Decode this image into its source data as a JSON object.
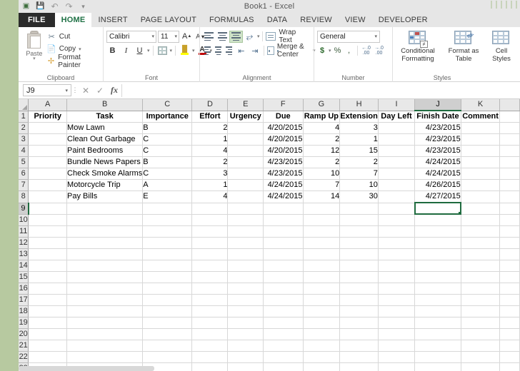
{
  "window": {
    "title": "Book1 - Excel",
    "quick_access": [
      "excel-logo",
      "save-icon",
      "undo-icon",
      "redo-icon",
      "customize-qat-icon"
    ]
  },
  "tabs": [
    {
      "label": "FILE",
      "state": "file"
    },
    {
      "label": "HOME",
      "state": "active"
    },
    {
      "label": "INSERT",
      "state": "normal"
    },
    {
      "label": "PAGE LAYOUT",
      "state": "normal"
    },
    {
      "label": "FORMULAS",
      "state": "normal"
    },
    {
      "label": "DATA",
      "state": "normal"
    },
    {
      "label": "REVIEW",
      "state": "normal"
    },
    {
      "label": "VIEW",
      "state": "normal"
    },
    {
      "label": "DEVELOPER",
      "state": "normal"
    }
  ],
  "ribbon": {
    "clipboard": {
      "group_label": "Clipboard",
      "paste_label": "Paste",
      "cut_label": "Cut",
      "copy_label": "Copy",
      "format_painter_label": "Format Painter"
    },
    "font": {
      "group_label": "Font",
      "font_name": "Calibri",
      "font_size": "11",
      "bold_label": "B",
      "italic_label": "I",
      "underline_label": "U",
      "grow_font_label": "A",
      "shrink_font_label": "A",
      "font_color_label": "A"
    },
    "alignment": {
      "group_label": "Alignment",
      "wrap_text_label": "Wrap Text",
      "merge_center_label": "Merge & Center"
    },
    "number": {
      "group_label": "Number",
      "format": "General",
      "currency_label": "$",
      "percent_label": "%",
      "comma_label": ","
    },
    "styles": {
      "group_label": "Styles",
      "conditional_formatting_label": "Conditional Formatting",
      "format_as_table_label": "Format as Table",
      "cell_styles_label": "Cell Styles"
    }
  },
  "formula_bar": {
    "name_box": "J9",
    "cancel_label": "✕",
    "enter_label": "✓",
    "function_label": "fx",
    "formula_value": ""
  },
  "sheet": {
    "columns": [
      "A",
      "B",
      "C",
      "D",
      "E",
      "F",
      "G",
      "H",
      "I",
      "J",
      "K"
    ],
    "selected_column": "J",
    "selected_row": 9,
    "selected_cell": "J9",
    "row_count": 23,
    "headers": [
      "Priority",
      "Task",
      "Importance",
      "Effort",
      "Urgency",
      "Due",
      "Ramp Up",
      "Extension",
      "Day Left",
      "Finish Date",
      "Comment"
    ],
    "rows": [
      {
        "priority": "",
        "task": "Mow Lawn",
        "importance": "B",
        "effort": "2",
        "urgency": "",
        "due": "4/20/2015",
        "ramp_up": "4",
        "extension": "3",
        "day_left": "",
        "finish_date": "4/23/2015",
        "comment": ""
      },
      {
        "priority": "",
        "task": "Clean Out Garbage",
        "importance": "C",
        "effort": "1",
        "urgency": "",
        "due": "4/20/2015",
        "ramp_up": "2",
        "extension": "1",
        "day_left": "",
        "finish_date": "4/23/2015",
        "comment": ""
      },
      {
        "priority": "",
        "task": "Paint Bedrooms",
        "importance": "C",
        "effort": "4",
        "urgency": "",
        "due": "4/20/2015",
        "ramp_up": "12",
        "extension": "15",
        "day_left": "",
        "finish_date": "4/23/2015",
        "comment": ""
      },
      {
        "priority": "",
        "task": "Bundle News Papers",
        "importance": "B",
        "effort": "2",
        "urgency": "",
        "due": "4/23/2015",
        "ramp_up": "2",
        "extension": "2",
        "day_left": "",
        "finish_date": "4/24/2015",
        "comment": ""
      },
      {
        "priority": "",
        "task": "Check Smoke Alarms",
        "importance": "C",
        "effort": "3",
        "urgency": "",
        "due": "4/23/2015",
        "ramp_up": "10",
        "extension": "7",
        "day_left": "",
        "finish_date": "4/24/2015",
        "comment": ""
      },
      {
        "priority": "",
        "task": "Motorcycle Trip",
        "importance": "A",
        "effort": "1",
        "urgency": "",
        "due": "4/24/2015",
        "ramp_up": "7",
        "extension": "10",
        "day_left": "",
        "finish_date": "4/26/2015",
        "comment": ""
      },
      {
        "priority": "",
        "task": "Pay Bills",
        "importance": "E",
        "effort": "4",
        "urgency": "",
        "due": "4/24/2015",
        "ramp_up": "14",
        "extension": "30",
        "day_left": "",
        "finish_date": "4/27/2015",
        "comment": ""
      }
    ]
  },
  "colors": {
    "accent_green": "#1f6b3f",
    "window_frame": "#b7c9a0",
    "ribbon_bg": "#ffffff",
    "header_bg": "#e8e8e8",
    "selected_header_bg": "#cfcfcf"
  }
}
